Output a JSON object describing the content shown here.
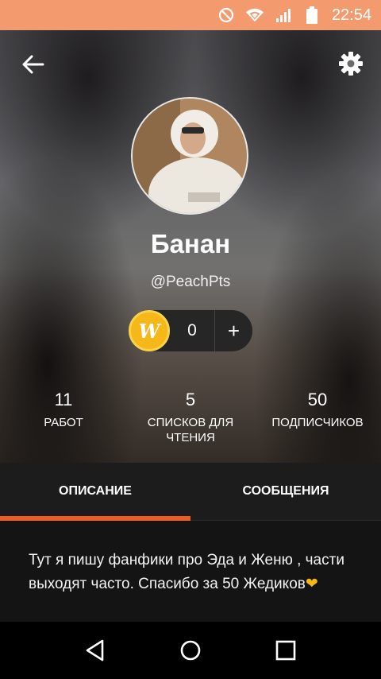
{
  "status_bar": {
    "time": "22:54"
  },
  "profile": {
    "name": "Банан",
    "handle": "@PeachPts",
    "coins": "0",
    "coin_symbol": "W",
    "plus": "+"
  },
  "stats": [
    {
      "number": "11",
      "label": "РАБОТ"
    },
    {
      "number": "5",
      "label": "СПИСКОВ ДЛЯ ЧТЕНИЯ"
    },
    {
      "number": "50",
      "label": "ПОДПИСЧИКОВ"
    }
  ],
  "tabs": [
    {
      "label": "ОПИСАНИЕ",
      "active": true
    },
    {
      "label": "СООБЩЕНИЯ",
      "active": false
    }
  ],
  "description": "Тут я пишу фанфики про Эда и Женю , части выходят часто. Спасибо за 50 Жедиков",
  "description_emoji": "❤",
  "colors": {
    "status_bar": "#f39a6f",
    "accent": "#f05d22",
    "coin": "#f6b719"
  },
  "icons": [
    "no-disturb-icon",
    "wifi-icon",
    "signal-icon",
    "battery-icon",
    "back-arrow-icon",
    "gear-icon",
    "plus-icon",
    "nav-back-icon",
    "nav-home-icon",
    "nav-recents-icon"
  ]
}
